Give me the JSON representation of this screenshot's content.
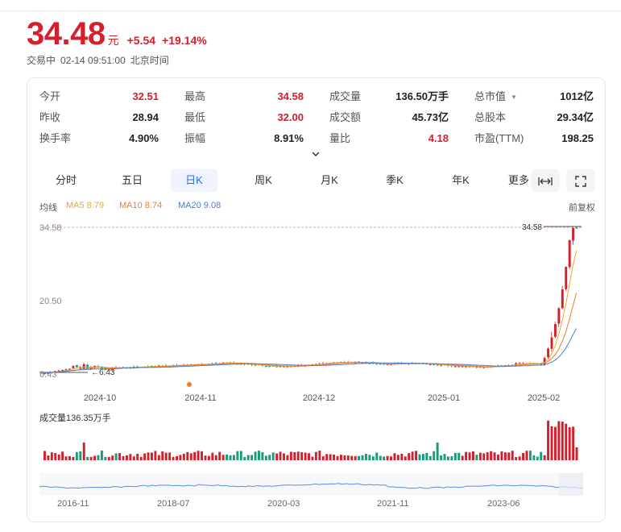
{
  "quote": {
    "price": "34.48",
    "unit": "元",
    "change": "+5.54",
    "change_pct": "+19.14%",
    "status": "交易中",
    "datetime": "02-14 09:51:00",
    "tz": "北京时间"
  },
  "stats": [
    [
      {
        "label": "今开",
        "value": "32.51",
        "color": "red"
      },
      {
        "label": "最高",
        "value": "34.58",
        "color": "red"
      },
      {
        "label": "成交量",
        "value": "136.50万手",
        "color": "dark"
      },
      {
        "label": "总市值",
        "value": "1012亿",
        "color": "dark"
      }
    ],
    [
      {
        "label": "昨收",
        "value": "28.94",
        "color": "dark"
      },
      {
        "label": "最低",
        "value": "32.00",
        "color": "red"
      },
      {
        "label": "成交额",
        "value": "45.73亿",
        "color": "dark"
      },
      {
        "label": "总股本",
        "value": "29.34亿",
        "color": "dark"
      }
    ],
    [
      {
        "label": "换手率",
        "value": "4.90%",
        "color": "dark"
      },
      {
        "label": "振幅",
        "value": "8.91%",
        "color": "dark"
      },
      {
        "label": "量比",
        "value": "4.18",
        "color": "red"
      },
      {
        "label": "市盈(TTM)",
        "value": "198.25",
        "color": "dark"
      }
    ]
  ],
  "tabs": [
    "分时",
    "五日",
    "日K",
    "周K",
    "月K",
    "季K",
    "年K",
    "更多"
  ],
  "active_tab": 2,
  "icons": {
    "dropdown": "caret-down-icon",
    "expand": "chevron-down-icon",
    "fullscreen_width": "arrows-horizontal-icon",
    "fullscreen": "expand-corners-icon"
  },
  "ma": {
    "label": "均线",
    "ma5": "MA5 8.79",
    "ma10": "MA10 8.74",
    "ma20": "MA20 9.08",
    "fq": "前复权"
  },
  "chart_data": {
    "type": "candlestick",
    "y_axis_labels": [
      "34.58",
      "20.50",
      "6.43"
    ],
    "high_label": "34.58",
    "low_label": "6.43",
    "x_labels": [
      "2024-10",
      "2024-11",
      "2024-12",
      "2025-01",
      "2025-02"
    ],
    "volume_label": "成交量136.35万手",
    "navigator_labels": [
      "2016-11",
      "2018-07",
      "2020-03",
      "2021-11",
      "2023-06"
    ],
    "colors": {
      "up": "#d41f2c",
      "down": "#1a9a78",
      "ma5": "#f0a530",
      "ma10": "#ee7b2c",
      "ma20": "#4a7fd3"
    }
  }
}
